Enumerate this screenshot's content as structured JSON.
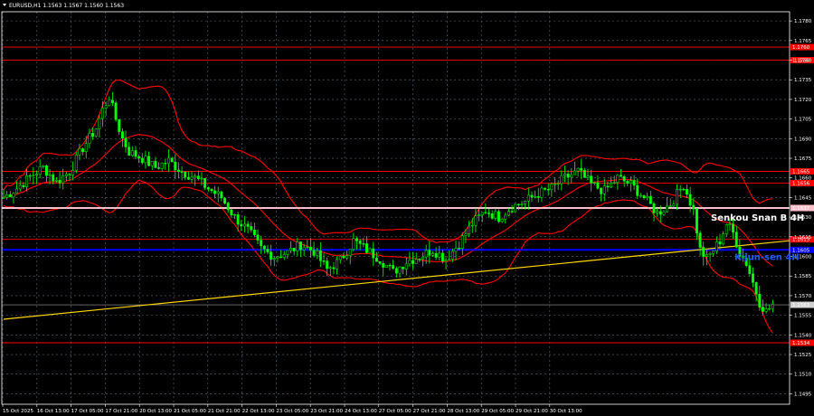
{
  "chart_data": {
    "type": "candlestick",
    "title": "EURUSD,H1  1.1563 1.1567 1.1560 1.1563",
    "symbol": "EURUSD",
    "timeframe": "H1",
    "ohlc_last": [
      1.1563,
      1.1567,
      1.156,
      1.1563
    ],
    "ylim": [
      1.1487,
      1.1787
    ],
    "y_ticks": [
      "1.1780",
      "1.1765",
      "1.1750",
      "1.1735",
      "1.1720",
      "1.1705",
      "1.1690",
      "1.1675",
      "1.1660",
      "1.1645",
      "1.1630",
      "1.1615",
      "1.1600",
      "1.1585",
      "1.1570",
      "1.1555",
      "1.1540",
      "1.1525",
      "1.1510",
      "1.1495"
    ],
    "x_ticks": [
      "15 Oct 2025",
      "16 Oct 13:00",
      "17 Oct 05:00",
      "17 Oct 21:00",
      "20 Oct 13:00",
      "21 Oct 05:00",
      "21 Oct 21:00",
      "22 Oct 13:00",
      "23 Oct 05:00",
      "23 Oct 21:00",
      "24 Oct 13:00",
      "27 Oct 05:00",
      "27 Oct 21:00",
      "28 Oct 13:00",
      "29 Oct 05:00",
      "29 Oct 21:00",
      "30 Oct 13:00"
    ],
    "grid": true,
    "price_path": [
      [
        0,
        1.1645
      ],
      [
        4,
        1.1652
      ],
      [
        8,
        1.1661
      ],
      [
        12,
        1.1668
      ],
      [
        16,
        1.1657
      ],
      [
        20,
        1.1665
      ],
      [
        24,
        1.1683
      ],
      [
        28,
        1.1698
      ],
      [
        30,
        1.1712
      ],
      [
        32,
        1.1722
      ],
      [
        34,
        1.1705
      ],
      [
        36,
        1.169
      ],
      [
        38,
        1.168
      ],
      [
        42,
        1.1675
      ],
      [
        46,
        1.1668
      ],
      [
        50,
        1.1673
      ],
      [
        54,
        1.1665
      ],
      [
        58,
        1.166
      ],
      [
        62,
        1.1652
      ],
      [
        66,
        1.1645
      ],
      [
        70,
        1.163
      ],
      [
        74,
        1.162
      ],
      [
        78,
        1.1606
      ],
      [
        82,
        1.16
      ],
      [
        86,
        1.1603
      ],
      [
        90,
        1.1609
      ],
      [
        94,
        1.1604
      ],
      [
        98,
        1.159
      ],
      [
        102,
        1.1597
      ],
      [
        106,
        1.1612
      ],
      [
        110,
        1.1605
      ],
      [
        114,
        1.1598
      ],
      [
        118,
        1.1588
      ],
      [
        122,
        1.1596
      ],
      [
        126,
        1.16
      ],
      [
        130,
        1.1605
      ],
      [
        134,
        1.1598
      ],
      [
        138,
        1.161
      ],
      [
        142,
        1.1625
      ],
      [
        146,
        1.1635
      ],
      [
        150,
        1.163
      ],
      [
        154,
        1.1638
      ],
      [
        158,
        1.1642
      ],
      [
        162,
        1.1648
      ],
      [
        166,
        1.1652
      ],
      [
        170,
        1.166
      ],
      [
        174,
        1.1665
      ],
      [
        178,
        1.1655
      ],
      [
        182,
        1.165
      ],
      [
        186,
        1.166
      ],
      [
        190,
        1.1655
      ],
      [
        194,
        1.1645
      ],
      [
        198,
        1.1633
      ],
      [
        202,
        1.164
      ],
      [
        206,
        1.1655
      ],
      [
        209,
        1.1635
      ],
      [
        211,
        1.1605
      ],
      [
        213,
        1.1598
      ],
      [
        215,
        1.1605
      ],
      [
        217,
        1.1612
      ],
      [
        219,
        1.1625
      ],
      [
        221,
        1.1618
      ],
      [
        223,
        1.1603
      ],
      [
        225,
        1.1595
      ],
      [
        227,
        1.158
      ],
      [
        229,
        1.1565
      ],
      [
        231,
        1.1558
      ],
      [
        233,
        1.1563
      ]
    ],
    "hlines": [
      {
        "price": 1.176,
        "label": "1.1760",
        "color": "#ff0000",
        "kind": "level"
      },
      {
        "price": 1.175,
        "label": "1.1750",
        "color": "#ff0000",
        "kind": "level"
      },
      {
        "price": 1.1665,
        "label": "1.1665",
        "color": "#ff0000",
        "kind": "level"
      },
      {
        "price": 1.1656,
        "label": "1.1656",
        "color": "#ff0000",
        "kind": "level"
      },
      {
        "price": 1.1637,
        "label": "1.1637",
        "color": "#ffc0cb",
        "kind": "senkou"
      },
      {
        "price": 1.1613,
        "label": "1.1613",
        "color": "#ff0000",
        "kind": "level"
      },
      {
        "price": 1.1605,
        "label": "1.1605",
        "color": "#0000ff",
        "kind": "kijun"
      },
      {
        "price": 1.1563,
        "label": "1.1563",
        "color": "#9e9e9e",
        "kind": "current"
      },
      {
        "price": 1.1534,
        "label": "1.1534",
        "color": "#ff0000",
        "kind": "level"
      }
    ],
    "annotations": [
      {
        "text": "Senkou Snan B 4H",
        "color": "#ffffff"
      },
      {
        "text": "Kijun-sen 4H",
        "color": "#1e5bff"
      }
    ],
    "trendline": {
      "from": [
        0,
        1.1552
      ],
      "to": [
        238,
        1.1612
      ],
      "color": "#ffd700"
    },
    "colors": {
      "bull": "#00ff00",
      "bear": "#00ff00",
      "bollinger": "#ff0000",
      "grid": "#5a6a7a",
      "axis": "#ffffff"
    }
  }
}
